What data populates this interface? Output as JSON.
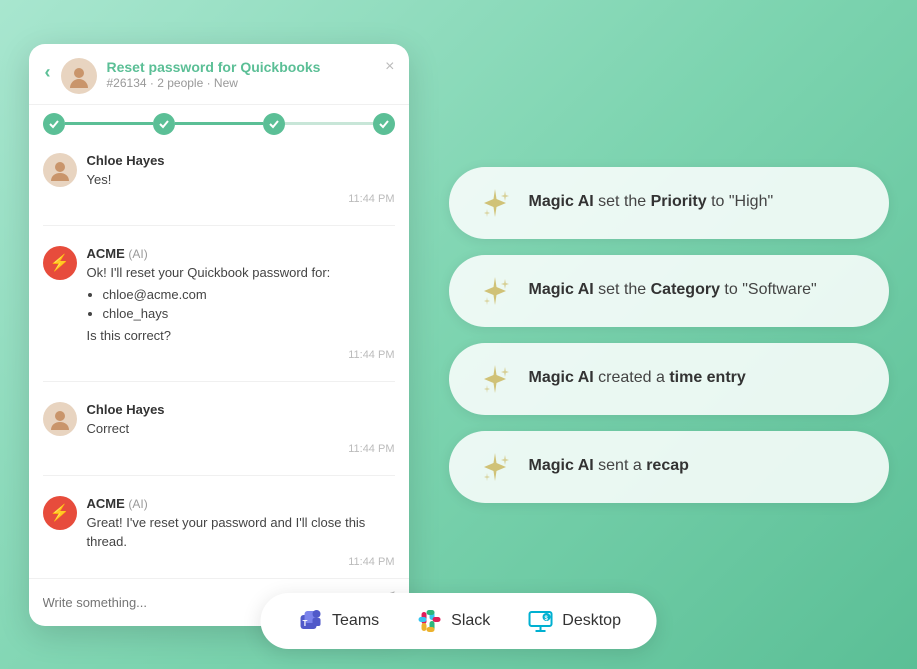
{
  "header": {
    "back_icon": "‹",
    "title": "Reset password for Quickbooks",
    "subtitle": "#26134 · 2 people · New",
    "close_icon": "×"
  },
  "progress": {
    "steps": [
      "done",
      "done",
      "active",
      "line",
      "done"
    ],
    "description": "4-step progress"
  },
  "messages": [
    {
      "id": 1,
      "sender": "human",
      "name": "Chloe Hayes",
      "text": "Yes!",
      "time": "11:44 PM"
    },
    {
      "id": 2,
      "sender": "bot",
      "name": "ACME",
      "ai_label": "(AI)",
      "text_lines": [
        "Ok! I'll reset your Quickbook password for:",
        "chloe@acme.com",
        "chloe_hays",
        "Is this correct?"
      ],
      "has_bullets": true,
      "time": "11:44 PM"
    },
    {
      "id": 3,
      "sender": "human",
      "name": "Chloe Hayes",
      "text": "Correct",
      "time": "11:44 PM"
    },
    {
      "id": 4,
      "sender": "bot",
      "name": "ACME",
      "ai_label": "(AI)",
      "text_lines": [
        "Great! I've reset your password and I'll close this thread."
      ],
      "has_bullets": false,
      "time": "11:44 PM"
    }
  ],
  "input": {
    "placeholder": "Write something..."
  },
  "ai_actions": [
    {
      "id": 1,
      "prefix": "Magic AI",
      "middle": "set the",
      "bold_word": "Priority",
      "suffix": "to \"High\""
    },
    {
      "id": 2,
      "prefix": "Magic AI",
      "middle": "set the",
      "bold_word": "Category",
      "suffix": "to \"Software\""
    },
    {
      "id": 3,
      "prefix": "Magic AI",
      "middle": "created a",
      "bold_word": "time entry",
      "suffix": ""
    },
    {
      "id": 4,
      "prefix": "Magic AI",
      "middle": "sent a",
      "bold_word": "recap",
      "suffix": ""
    }
  ],
  "bottom_bar": {
    "items": [
      {
        "id": "teams",
        "label": "Teams",
        "color": "#5059C9"
      },
      {
        "id": "slack",
        "label": "Slack",
        "color": "#E01E5A"
      },
      {
        "id": "desktop",
        "label": "Desktop",
        "color": "#00B0D1"
      }
    ]
  }
}
